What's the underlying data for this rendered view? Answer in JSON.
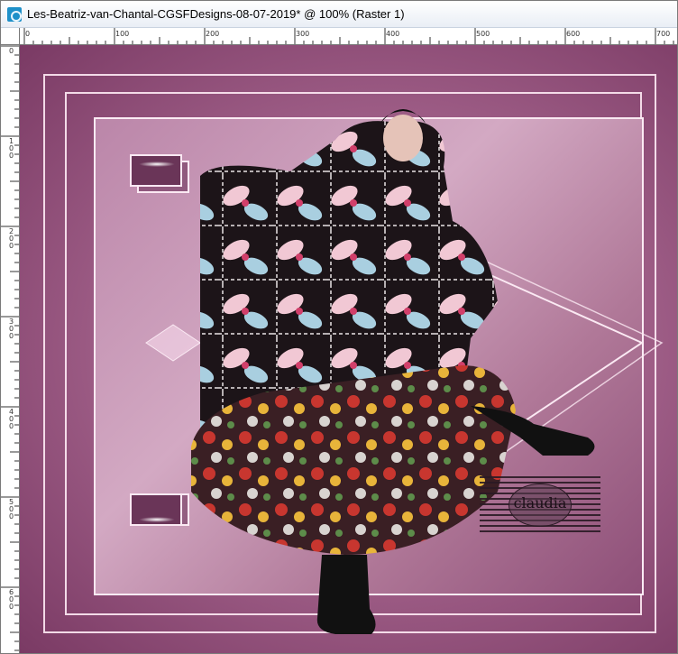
{
  "window": {
    "title": "Les-Beatriz-van-Chantal-CGSFDesigns-08-07-2019* @ 100% (Raster 1)"
  },
  "ruler": {
    "horizontal_labels": [
      "0",
      "100",
      "200",
      "300",
      "400",
      "500",
      "600",
      "700"
    ],
    "vertical_labels": [
      "0",
      "100",
      "200",
      "300",
      "400",
      "500",
      "600"
    ]
  },
  "canvas": {
    "watermark": "claudia",
    "colors": {
      "background": "#a4638c",
      "frame": "#fbe9f3"
    }
  }
}
